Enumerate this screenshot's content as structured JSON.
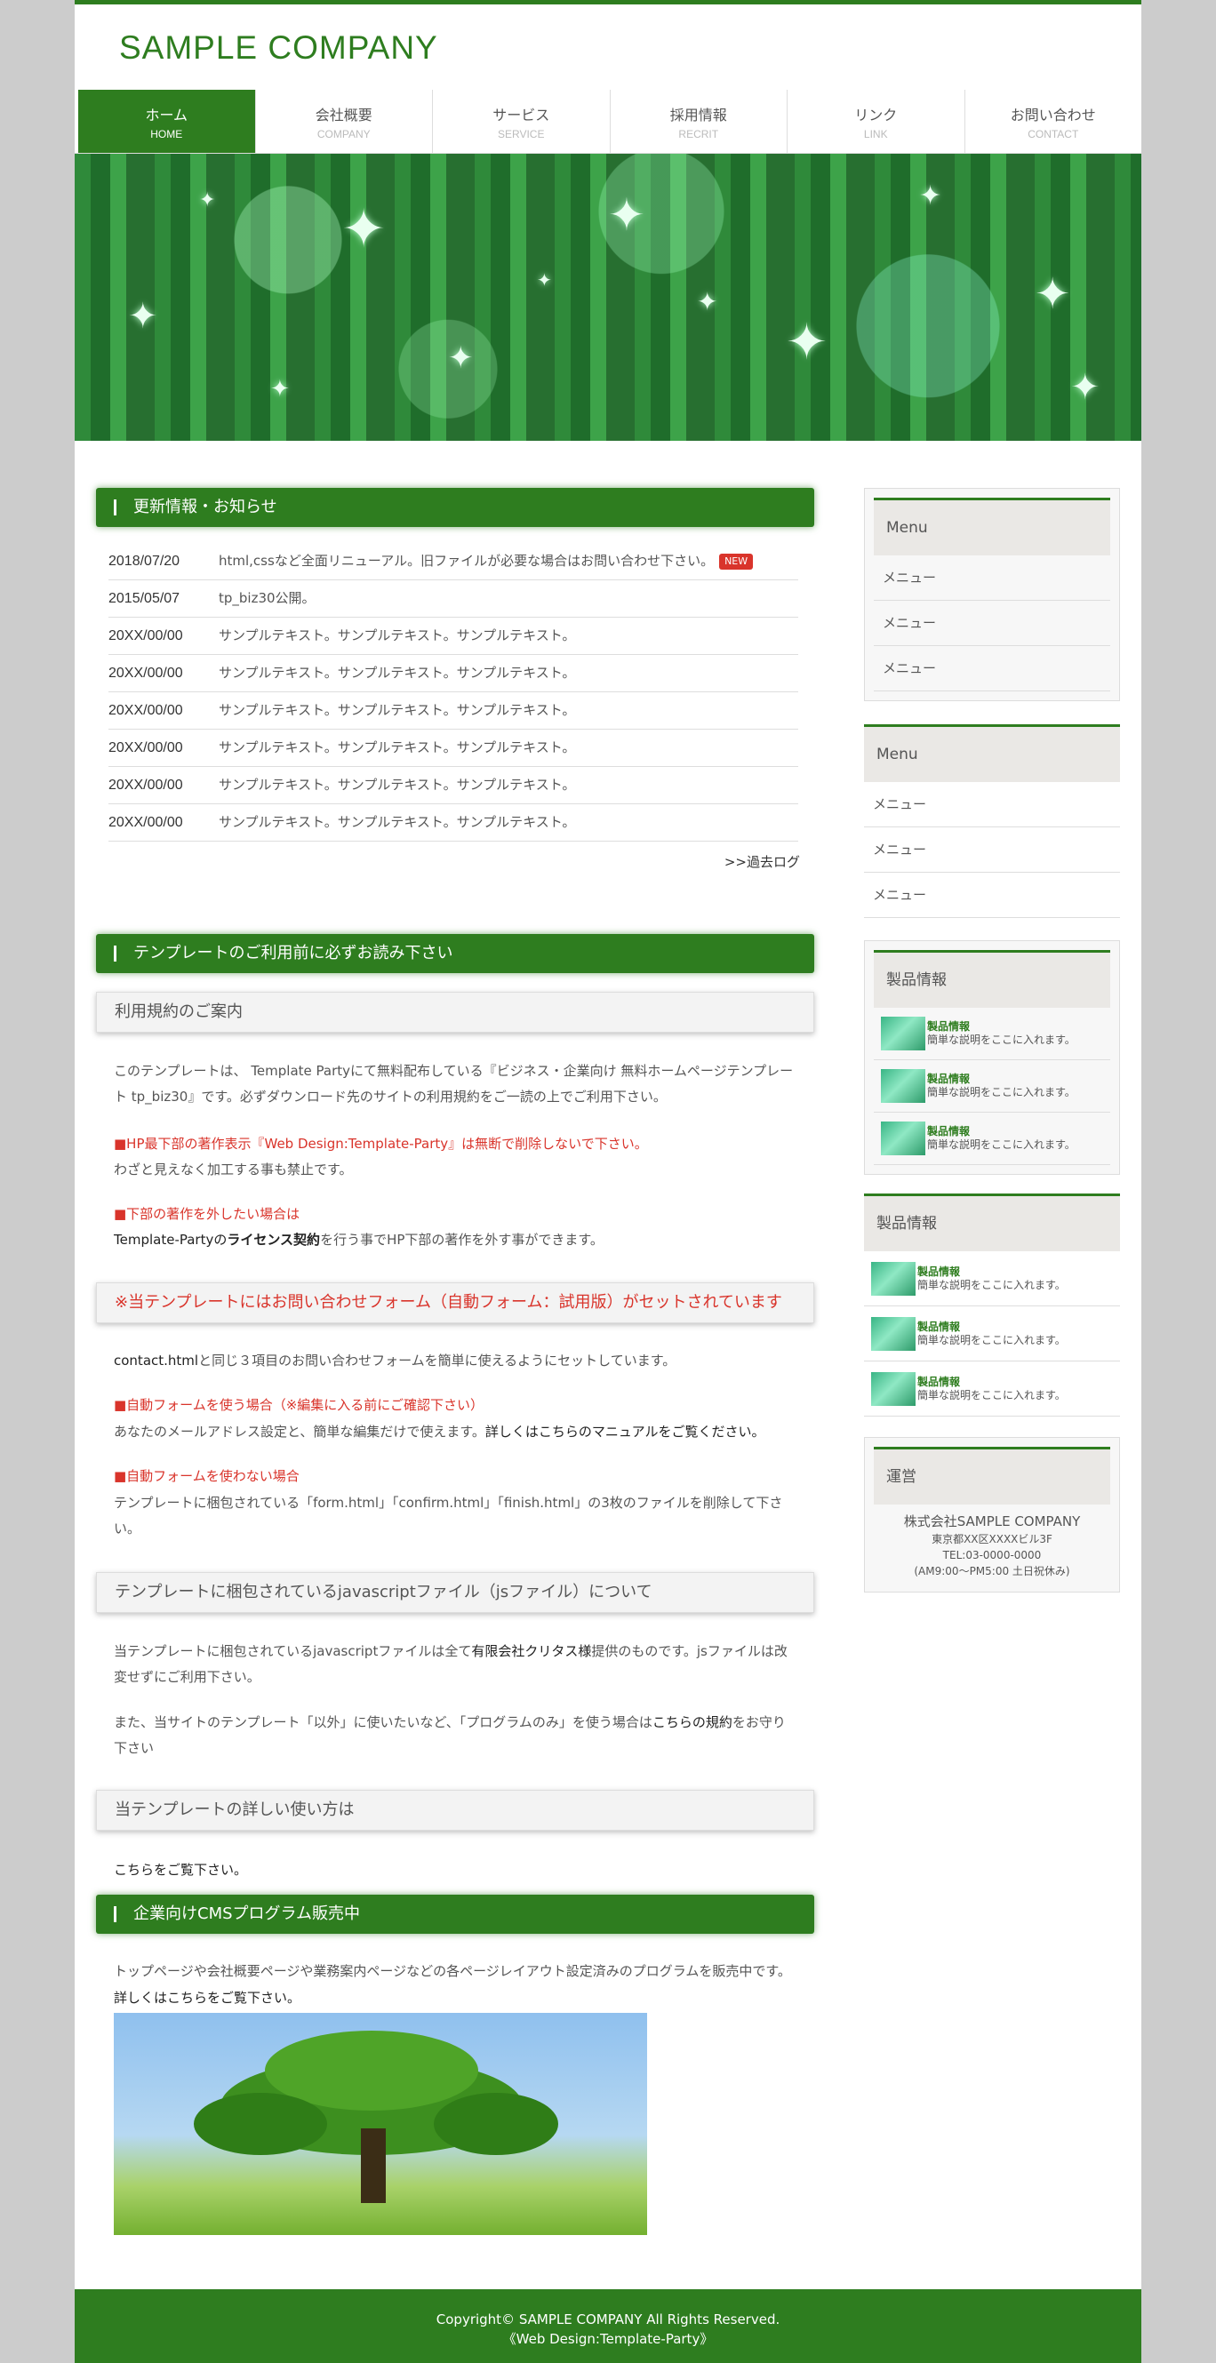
{
  "header": {
    "logo": "SAMPLE COMPANY"
  },
  "nav": [
    {
      "jp": "ホーム",
      "en": "HOME"
    },
    {
      "jp": "会社概要",
      "en": "COMPANY"
    },
    {
      "jp": "サービス",
      "en": "SERVICE"
    },
    {
      "jp": "採用情報",
      "en": "RECRIT"
    },
    {
      "jp": "リンク",
      "en": "LINK"
    },
    {
      "jp": "お問い合わせ",
      "en": "CONTACT"
    }
  ],
  "news": {
    "heading": "更新情報・お知らせ",
    "items": [
      {
        "date": "2018/07/20",
        "text": "html,cssなど全面リニューアル。旧ファイルが必要な場合はお問い合わせ下さい。",
        "badge": "NEW"
      },
      {
        "date": "2015/05/07",
        "text": "tp_biz30公開。"
      },
      {
        "date": "20XX/00/00",
        "text": "サンプルテキスト。サンプルテキスト。サンプルテキスト。"
      },
      {
        "date": "20XX/00/00",
        "text": "サンプルテキスト。サンプルテキスト。サンプルテキスト。"
      },
      {
        "date": "20XX/00/00",
        "text": "サンプルテキスト。サンプルテキスト。サンプルテキスト。"
      },
      {
        "date": "20XX/00/00",
        "text": "サンプルテキスト。サンプルテキスト。サンプルテキスト。"
      },
      {
        "date": "20XX/00/00",
        "text": "サンプルテキスト。サンプルテキスト。サンプルテキスト。"
      },
      {
        "date": "20XX/00/00",
        "text": "サンプルテキスト。サンプルテキスト。サンプルテキスト。"
      }
    ],
    "more": ">>過去ログ"
  },
  "template": {
    "heading": "テンプレートのご利用前に必ずお読み下さい",
    "terms_title": "利用規約のご案内",
    "terms_p1": "このテンプレートは、 Template Partyにて無料配布している『ビジネス・企業向け 無料ホームページテンプレート tp_biz30』です。必ずダウンロード先のサイトの利用規約をご一読の上でご利用下さい。",
    "terms_warn1": "■HP最下部の著作表示『Web Design:Template-Party』は無断で削除しないで下さい。",
    "terms_p2": "わざと見えなく加工する事も禁止です。",
    "terms_warn2": "■下部の著作を外したい場合は",
    "terms_p3a": "Template-Partyの",
    "terms_p3b": "ライセンス契約",
    "terms_p3c": "を行う事でHP下部の著作を外す事ができます。",
    "form_title": "※当テンプレートにはお問い合わせフォーム（自動フォーム：試用版）がセットされています",
    "form_p1a": "contact.html",
    "form_p1b": "と同じ３項目のお問い合わせフォームを簡単に使えるようにセットしています。",
    "form_warn1": "■自動フォームを使う場合（※編集に入る前にご確認下さい）",
    "form_p2a": "あなたのメールアドレス設定と、簡単な編集だけで使えます。",
    "form_p2b": "詳しくはこちらのマニュアルをご覧ください。",
    "form_warn2": "■自動フォームを使わない場合",
    "form_p3": "テンプレートに梱包されている「form.html」「confirm.html」「finish.html」の3枚のファイルを削除して下さい。",
    "js_title": "テンプレートに梱包されているjavascriptファイル（jsファイル）について",
    "js_p1a": "当テンプレートに梱包されているjavascriptファイルは全て",
    "js_p1b": "有限会社クリタス様",
    "js_p1c": "提供のものです。jsファイルは改変せずにご利用下さい。",
    "js_p2a": "また、当サイトのテンプレート「以外」に使いたいなど、「プログラムのみ」を使う場合は",
    "js_p2b": "こちらの規約",
    "js_p2c": "をお守り下さい",
    "usage_title": "当テンプレートの詳しい使い方は",
    "usage_link": "こちらをご覧下さい。"
  },
  "cms": {
    "heading": "企業向けCMSプログラム販売中",
    "p1": "トップページや会社概要ページや業務案内ページなどの各ページレイアウト設定済みのプログラムを販売中です。",
    "link": "詳しくはこちらをご覧下さい。"
  },
  "sidebar": {
    "menu1": {
      "title": "Menu",
      "items": [
        "メニュー",
        "メニュー",
        "メニュー"
      ]
    },
    "menu2": {
      "title": "Menu",
      "items": [
        "メニュー",
        "メニュー",
        "メニュー"
      ]
    },
    "prod1": {
      "title": "製品情報",
      "items": [
        {
          "name": "製品情報",
          "desc": "簡単な説明をここに入れます。"
        },
        {
          "name": "製品情報",
          "desc": "簡単な説明をここに入れます。"
        },
        {
          "name": "製品情報",
          "desc": "簡単な説明をここに入れます。"
        }
      ]
    },
    "prod2": {
      "title": "製品情報",
      "items": [
        {
          "name": "製品情報",
          "desc": "簡単な説明をここに入れます。"
        },
        {
          "name": "製品情報",
          "desc": "簡単な説明をここに入れます。"
        },
        {
          "name": "製品情報",
          "desc": "簡単な説明をここに入れます。"
        }
      ]
    },
    "unei": {
      "title": "運営",
      "company": "株式会社SAMPLE COMPANY",
      "address": "東京都XX区XXXXビル3F",
      "tel": "TEL:03-0000-0000",
      "hours": "(AM9:00〜PM5:00 土日祝休み)"
    }
  },
  "footer": {
    "copyright": "Copyright© SAMPLE COMPANY All Rights Reserved.",
    "credit": "《Web Design:Template-Party》"
  },
  "colors": {
    "brand": "#2e7d1f",
    "accent_red": "#d9342b",
    "page_bg": "#cccccc"
  }
}
